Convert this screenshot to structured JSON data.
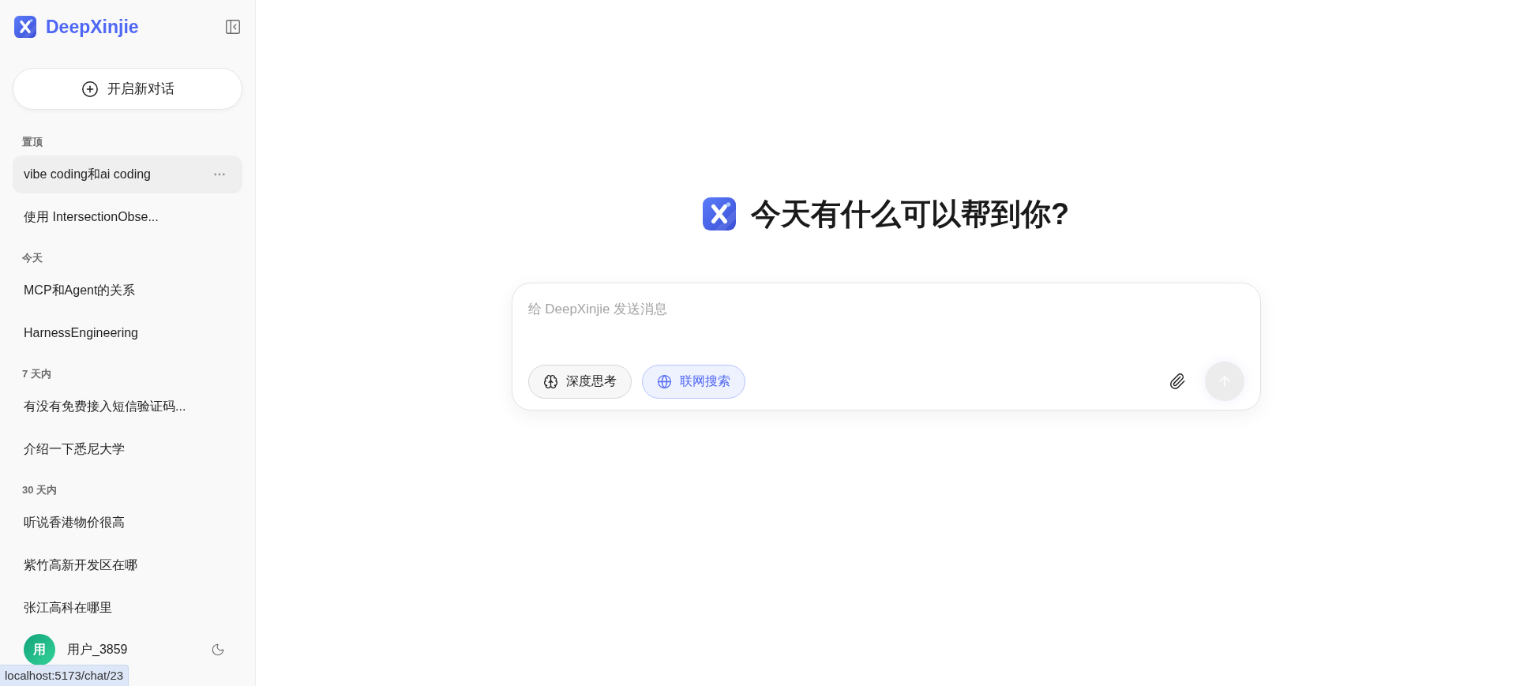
{
  "sidebar": {
    "brand": "DeepXinjie",
    "new_chat_label": "开启新对话",
    "sections": [
      {
        "title": "置顶",
        "items": [
          {
            "label": "vibe coding和ai coding",
            "selected": true
          },
          {
            "label": "使用 IntersectionObse...",
            "selected": false
          }
        ]
      },
      {
        "title": "今天",
        "items": [
          {
            "label": "MCP和Agent的关系",
            "selected": false
          },
          {
            "label": "HarnessEngineering",
            "selected": false
          }
        ]
      },
      {
        "title": "7 天内",
        "items": [
          {
            "label": "有没有免费接入短信验证码...",
            "selected": false
          },
          {
            "label": "介绍一下悉尼大学",
            "selected": false
          }
        ]
      },
      {
        "title": "30 天内",
        "items": [
          {
            "label": "听说香港物价很高",
            "selected": false
          },
          {
            "label": "紫竹高新开发区在哪",
            "selected": false
          },
          {
            "label": "张江高科在哪里",
            "selected": false
          }
        ]
      }
    ],
    "user": {
      "avatar_text": "用",
      "name": "用户_3859"
    }
  },
  "main": {
    "greeting": "今天有什么可以帮到你?",
    "composer": {
      "placeholder": "给 DeepXinjie 发送消息",
      "toggles": [
        {
          "label": "深度思考",
          "on": false
        },
        {
          "label": "联网搜索",
          "on": true
        }
      ],
      "send_button": {
        "disabled": true
      }
    }
  },
  "browser_status": {
    "url": "localhost:5173/chat/23"
  }
}
